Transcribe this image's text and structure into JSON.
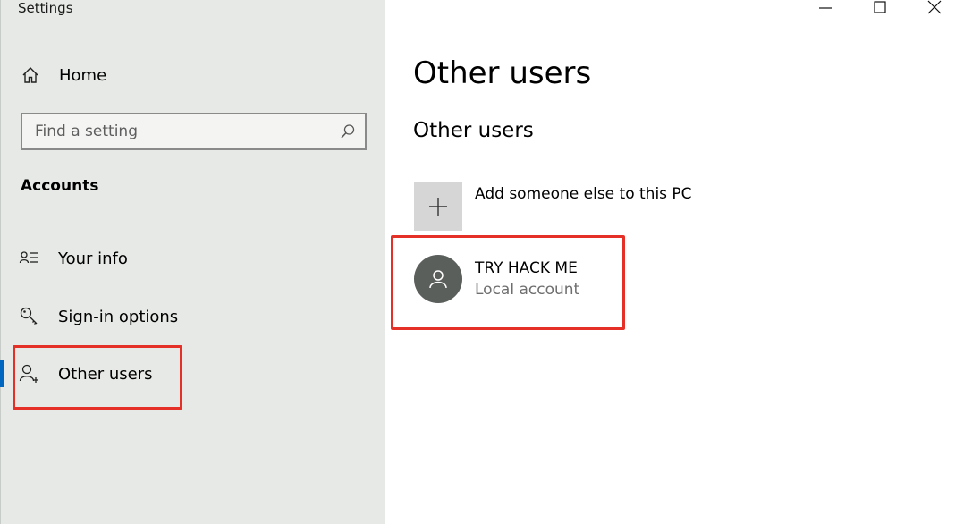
{
  "window": {
    "title": "Settings",
    "controls": [
      "minimize-icon",
      "maximize-icon",
      "close-icon"
    ]
  },
  "sidebar": {
    "home_label": "Home",
    "search": {
      "placeholder": "Find a setting",
      "value": ""
    },
    "section_heading": "Accounts",
    "items": [
      {
        "label": "Your info",
        "icon": "person-list-icon",
        "selected": false
      },
      {
        "label": "Sign-in options",
        "icon": "key-icon",
        "selected": false
      },
      {
        "label": "Other users",
        "icon": "person-add-icon",
        "selected": true
      }
    ]
  },
  "main": {
    "page_title": "Other users",
    "section_title": "Other users",
    "add_user_label": "Add someone else to this PC",
    "users": [
      {
        "name": "TRY HACK ME",
        "account_type": "Local account"
      }
    ]
  },
  "colors": {
    "sidebar_bg": "#e6e9e5",
    "accent": "#0067c0",
    "highlight": "#e53027",
    "avatar_bg": "#5b5f5c"
  }
}
